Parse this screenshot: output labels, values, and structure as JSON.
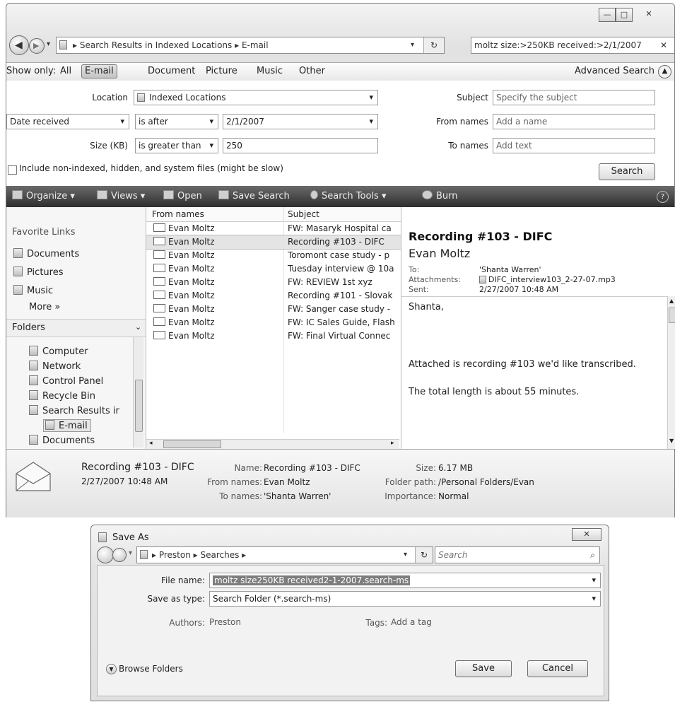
{
  "window": {
    "caption_buttons": [
      "—",
      "□",
      "✕"
    ],
    "breadcrumb": [
      "Search Results in Indexed Locations",
      "E-mail"
    ],
    "search_query": "moltz size:>250KB received:>2/1/2007",
    "search_clear": "✕"
  },
  "filter_bar": {
    "show_only": "Show only:",
    "items": [
      "All",
      "E-mail",
      "Document",
      "Picture",
      "Music",
      "Other"
    ],
    "selected": "E-mail",
    "advanced": "Advanced Search"
  },
  "advanced": {
    "location_label": "Location",
    "location_value": "Indexed Locations",
    "date_field": "Date received",
    "date_op": "is after",
    "date_value": "2/1/2007",
    "size_label": "Size (KB)",
    "size_op": "is greater than",
    "size_value": "250",
    "include_label": "Include non-indexed, hidden, and system files (might be slow)",
    "subject_label": "Subject",
    "subject_placeholder": "Specify the subject",
    "from_label": "From names",
    "from_placeholder": "Add a name",
    "to_label": "To names",
    "to_placeholder": "Add text",
    "search_button": "Search"
  },
  "toolbar": {
    "organize": "Organize",
    "views": "Views",
    "open": "Open",
    "save_search": "Save Search",
    "search_tools": "Search Tools",
    "burn": "Burn",
    "help": "?"
  },
  "nav_pane": {
    "favorite_links": "Favorite Links",
    "favorites": [
      "Documents",
      "Pictures",
      "Music"
    ],
    "more": "More »",
    "folders": "Folders",
    "folder_items": [
      "Computer",
      "Network",
      "Control Panel",
      "Recycle Bin",
      "Search Results ir",
      "E-mail",
      "Documents"
    ]
  },
  "list": {
    "col_from": "From names",
    "col_subject": "Subject",
    "rows": [
      {
        "from": "Evan Moltz",
        "subject": "FW: Masaryk Hospital ca"
      },
      {
        "from": "Evan Moltz",
        "subject": "Recording #103 - DIFC"
      },
      {
        "from": "Evan Moltz",
        "subject": "Toromont case study - p"
      },
      {
        "from": "Evan Moltz",
        "subject": "Tuesday interview @ 10a"
      },
      {
        "from": "Evan Moltz",
        "subject": "FW: REVIEW       1st xyz"
      },
      {
        "from": "Evan Moltz",
        "subject": "Recording #101 - Slovak"
      },
      {
        "from": "Evan Moltz",
        "subject": "FW: Sanger case study - "
      },
      {
        "from": "Evan Moltz",
        "subject": "FW: IC Sales Guide, Flash"
      },
      {
        "from": "Evan Moltz",
        "subject": "FW: Final Virtual Connec"
      }
    ],
    "selected_index": 1
  },
  "preview": {
    "title": "Recording #103 - DIFC",
    "sender": "Evan Moltz",
    "to_label": "To:",
    "to_value": "'Shanta Warren'",
    "attach_label": "Attachments:",
    "attach_value": "DIFC_interview103_2-27-07.mp3",
    "sent_label": "Sent:",
    "sent_value": "2/27/2007 10:48 AM",
    "body": [
      "Shanta,",
      "Attached is recording #103 we'd like transcribed.",
      "The total length is about 55 minutes."
    ]
  },
  "details": {
    "title": "Recording #103 - DIFC",
    "date": "2/27/2007 10:48 AM",
    "name_label": "Name:",
    "name_value": "Recording #103 - DIFC",
    "from_label": "From names:",
    "from_value": "Evan Moltz",
    "to_label": "To names:",
    "to_value": "'Shanta Warren'",
    "size_label": "Size:",
    "size_value": "6.17 MB",
    "folder_label": "Folder path:",
    "folder_value": "/Personal Folders/Evan",
    "importance_label": "Importance:",
    "importance_value": "Normal"
  },
  "dialog": {
    "title": "Save As",
    "close": "✕",
    "breadcrumb": [
      "Preston",
      "Searches"
    ],
    "search_placeholder": "Search",
    "filename_label": "File name:",
    "filename_value": "moltz size250KB received2-1-2007.search-ms",
    "type_label": "Save as type:",
    "type_value": "Search Folder (*.search-ms)",
    "authors_label": "Authors:",
    "authors_value": "Preston",
    "tags_label": "Tags:",
    "tags_value": "Add a tag",
    "browse": "Browse Folders",
    "save": "Save",
    "cancel": "Cancel"
  }
}
